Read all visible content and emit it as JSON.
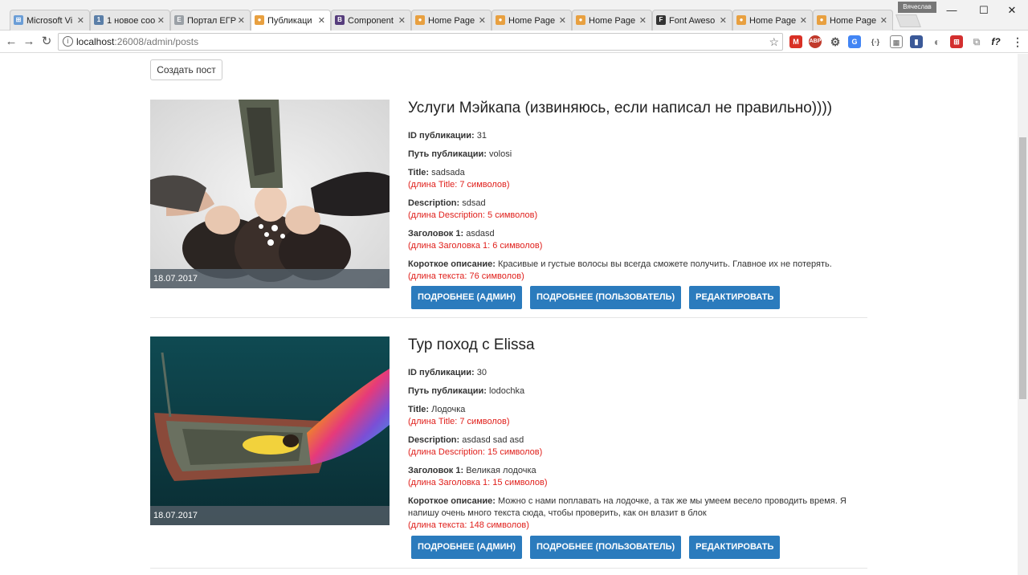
{
  "browser": {
    "tabs": [
      {
        "label": "Microsoft Vi",
        "color": "#6a9dd6"
      },
      {
        "label": "1 новое соо",
        "color": "#5b7fa8"
      },
      {
        "label": "Портал ЕГР",
        "color": "#9aa0a6"
      },
      {
        "label": "Публикаци",
        "color": "#e8a040"
      },
      {
        "label": "Component",
        "color": "#563d7c"
      },
      {
        "label": "Home Page",
        "color": "#e8a040"
      },
      {
        "label": "Home Page",
        "color": "#e8a040"
      },
      {
        "label": "Home Page",
        "color": "#e8a040"
      },
      {
        "label": "Font Aweso",
        "color": "#333333"
      },
      {
        "label": "Home Page",
        "color": "#e8a040"
      },
      {
        "label": "Home Page",
        "color": "#e8a040"
      }
    ],
    "profile_name": "Вячеслав",
    "url_host": "localhost",
    "url_rest": ":26008/admin/posts"
  },
  "page": {
    "create_button": "Создать пост",
    "posts": [
      {
        "title": "Услуги Мэйкапа (извиняюсь, если написал не правильно))))",
        "date": "18.07.2017",
        "id_label": "ID публикации:",
        "id_value": " 31",
        "path_label": "Путь публикации:",
        "path_value": " volosi",
        "title_label": "Title:",
        "title_value": " sadsada",
        "title_len": "(длина Title: 7 символов)",
        "desc_label": "Description:",
        "desc_value": " sdsad",
        "desc_len": "(длина Description: 5 символов)",
        "h1_label": "Заголовок 1:",
        "h1_value": " asdasd",
        "h1_len": "(длина Заголовка 1: 6 символов)",
        "short_label": "Короткое описание:",
        "short_value": " Красивые и густые волосы вы всегда сможете получить. Главное их не потерять.",
        "short_len": "(длина текста: 76 символов)",
        "btn_admin": "ПОДРОБНЕЕ (АДМИН)",
        "btn_user": "ПОДРОБНЕЕ (ПОЛЬЗОВАТЕЛЬ)",
        "btn_edit": "РЕДАКТИРОВАТЬ"
      },
      {
        "title": "Тур поход с Elissa",
        "date": "18.07.2017",
        "id_label": "ID публикации:",
        "id_value": " 30",
        "path_label": "Путь публикации:",
        "path_value": " lodochka",
        "title_label": "Title:",
        "title_value": " Лодочка",
        "title_len": "(длина Title: 7 символов)",
        "desc_label": "Description:",
        "desc_value": " asdasd sad asd",
        "desc_len": "(длина Description: 15 символов)",
        "h1_label": "Заголовок 1:",
        "h1_value": " Великая лодочка",
        "h1_len": "(длина Заголовка 1: 15 символов)",
        "short_label": "Короткое описание:",
        "short_value": " Можно с нами поплавать на лодочке, а так же мы умеем весело проводить время. Я напишу очень много текста сюда, чтобы проверить, как он влазит в блок",
        "short_len": "(длина текста: 148 символов)",
        "btn_admin": "ПОДРОБНЕЕ (АДМИН)",
        "btn_user": "ПОДРОБНЕЕ (ПОЛЬЗОВАТЕЛЬ)",
        "btn_edit": "РЕДАКТИРОВАТЬ"
      }
    ]
  }
}
